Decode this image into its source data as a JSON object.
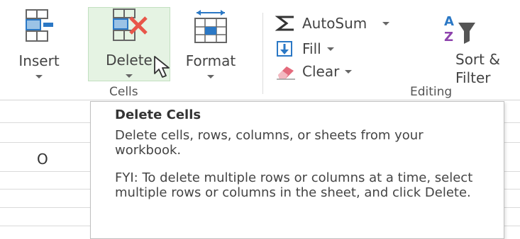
{
  "ribbon": {
    "cells_group": {
      "label": "Cells",
      "insert": {
        "label": "Insert",
        "icon": "insert-cells-icon"
      },
      "delete": {
        "label": "Delete",
        "icon": "delete-cells-icon"
      },
      "format": {
        "label": "Format",
        "icon": "format-cells-icon"
      }
    },
    "editing_group": {
      "label": "Editing",
      "autosum": {
        "label": "AutoSum",
        "icon": "sigma-icon"
      },
      "fill": {
        "label": "Fill",
        "icon": "fill-down-icon"
      },
      "clear": {
        "label": "Clear",
        "icon": "eraser-icon"
      },
      "sort_filter": {
        "label_line1": "Sort &",
        "label_line2": "Filter",
        "icon": "sort-filter-icon"
      }
    }
  },
  "sheet": {
    "visible_cell_value": "O"
  },
  "tooltip": {
    "title": "Delete Cells",
    "description": "Delete cells, rows, columns, or sheets from your workbook.",
    "fyi": "FYI: To delete multiple rows or columns at a time, select multiple rows or columns in the sheet, and click Delete."
  },
  "colors": {
    "hover_bg": "#e5f3e3",
    "delete_x": "#e8564a",
    "blue_accent": "#2b78c5",
    "eraser_pink": "#e46a7c"
  }
}
